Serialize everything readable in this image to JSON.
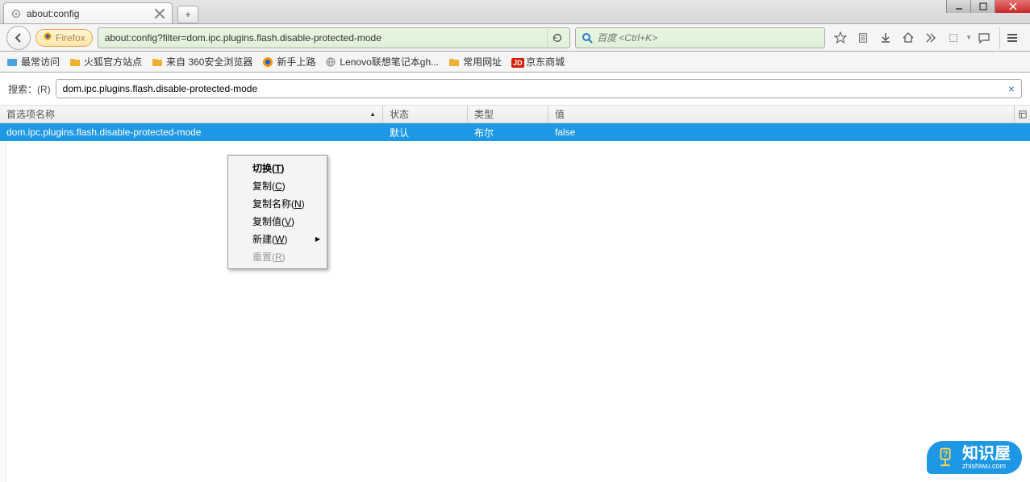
{
  "window": {
    "title": "about:config"
  },
  "tab": {
    "title": "about:config"
  },
  "identity": {
    "label": "Firefox"
  },
  "url": {
    "value": "about:config?filter=dom.ipc.plugins.flash.disable-protected-mode"
  },
  "searchbox": {
    "placeholder": "百度 <Ctrl+K>"
  },
  "bookmarks": [
    {
      "label": "最常访问",
      "color": "#4aa3df",
      "type": "bluefox"
    },
    {
      "label": "火狐官方站点",
      "color": "#f0b030",
      "type": "folder"
    },
    {
      "label": "来自 360安全浏览器",
      "color": "#f0b030",
      "type": "folder"
    },
    {
      "label": "新手上路",
      "color": "#ff7b00",
      "type": "ff"
    },
    {
      "label": "Lenovo联想笔记本gh...",
      "color": "#888",
      "type": "globe"
    },
    {
      "label": "常用网址",
      "color": "#f0b030",
      "type": "folder"
    },
    {
      "label": "京东商城",
      "color": "#d81e06",
      "type": "jd",
      "badge": "JD"
    }
  ],
  "filter": {
    "label": "搜索：(R)",
    "value": "dom.ipc.plugins.flash.disable-protected-mode"
  },
  "columns": {
    "name": "首选项名称",
    "status": "状态",
    "type": "类型",
    "value": "值"
  },
  "row": {
    "name": "dom.ipc.plugins.flash.disable-protected-mode",
    "status": "默认",
    "type": "布尔",
    "value": "false"
  },
  "context_menu": {
    "toggle": "切换(T)",
    "copy": "复制(C)",
    "copy_name": "复制名称(N)",
    "copy_value": "复制值(V)",
    "new": "新建(W)",
    "reset": "重置(R)"
  },
  "watermark": {
    "brand": "知识屋",
    "domain": "zhishiwu.com"
  }
}
